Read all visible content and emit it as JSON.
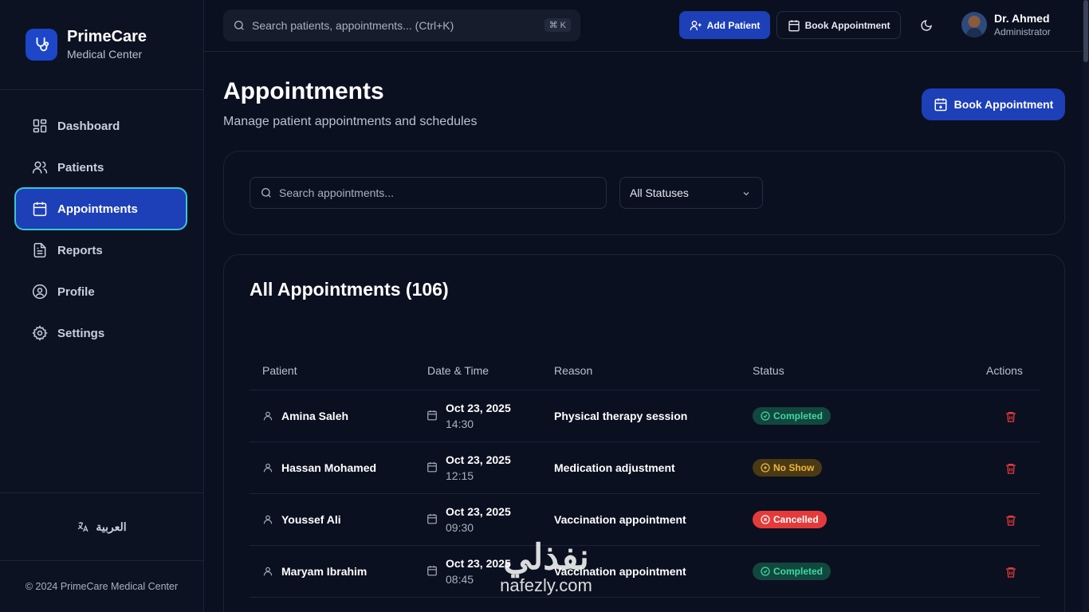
{
  "brand": {
    "name": "PrimeCare",
    "subtitle": "Medical Center"
  },
  "nav": [
    {
      "label": "Dashboard",
      "icon": "dashboard-icon"
    },
    {
      "label": "Patients",
      "icon": "users-icon"
    },
    {
      "label": "Appointments",
      "icon": "calendar-icon",
      "active": true
    },
    {
      "label": "Reports",
      "icon": "document-icon"
    },
    {
      "label": "Profile",
      "icon": "user-circle-icon"
    },
    {
      "label": "Settings",
      "icon": "gear-icon"
    }
  ],
  "sidebar_footer": {
    "language": "العربية",
    "copyright": "© 2024 PrimeCare Medical Center"
  },
  "topbar": {
    "search_placeholder": "Search patients, appointments... (Ctrl+K)",
    "shortcut": "⌘ K",
    "add_patient": "Add Patient",
    "book_appointment": "Book Appointment",
    "user_name": "Dr. Ahmed",
    "user_role": "Administrator"
  },
  "page": {
    "title": "Appointments",
    "subtitle": "Manage patient appointments and schedules",
    "book_button": "Book Appointment"
  },
  "filters": {
    "search_placeholder": "Search appointments...",
    "status_value": "All Statuses"
  },
  "table": {
    "title": "All Appointments (106)",
    "columns": [
      "Patient",
      "Date & Time",
      "Reason",
      "Status",
      "Actions"
    ],
    "rows": [
      {
        "patient": "Amina Saleh",
        "date": "Oct 23, 2025",
        "time": "14:30",
        "reason": "Physical therapy session",
        "status": "Completed"
      },
      {
        "patient": "Hassan Mohamed",
        "date": "Oct 23, 2025",
        "time": "12:15",
        "reason": "Medication adjustment",
        "status": "No Show"
      },
      {
        "patient": "Youssef Ali",
        "date": "Oct 23, 2025",
        "time": "09:30",
        "reason": "Vaccination appointment",
        "status": "Cancelled"
      },
      {
        "patient": "Maryam Ibrahim",
        "date": "Oct 23, 2025",
        "time": "08:45",
        "reason": "Vaccination appointment",
        "status": "Completed"
      }
    ]
  },
  "watermark": {
    "arabic": "نفذلي",
    "latin": "nafezly.com"
  },
  "colors": {
    "accent": "#1d3fb8",
    "completed": "#3fd8a0",
    "no_show": "#f2b43a",
    "cancelled": "#e53a3a"
  }
}
